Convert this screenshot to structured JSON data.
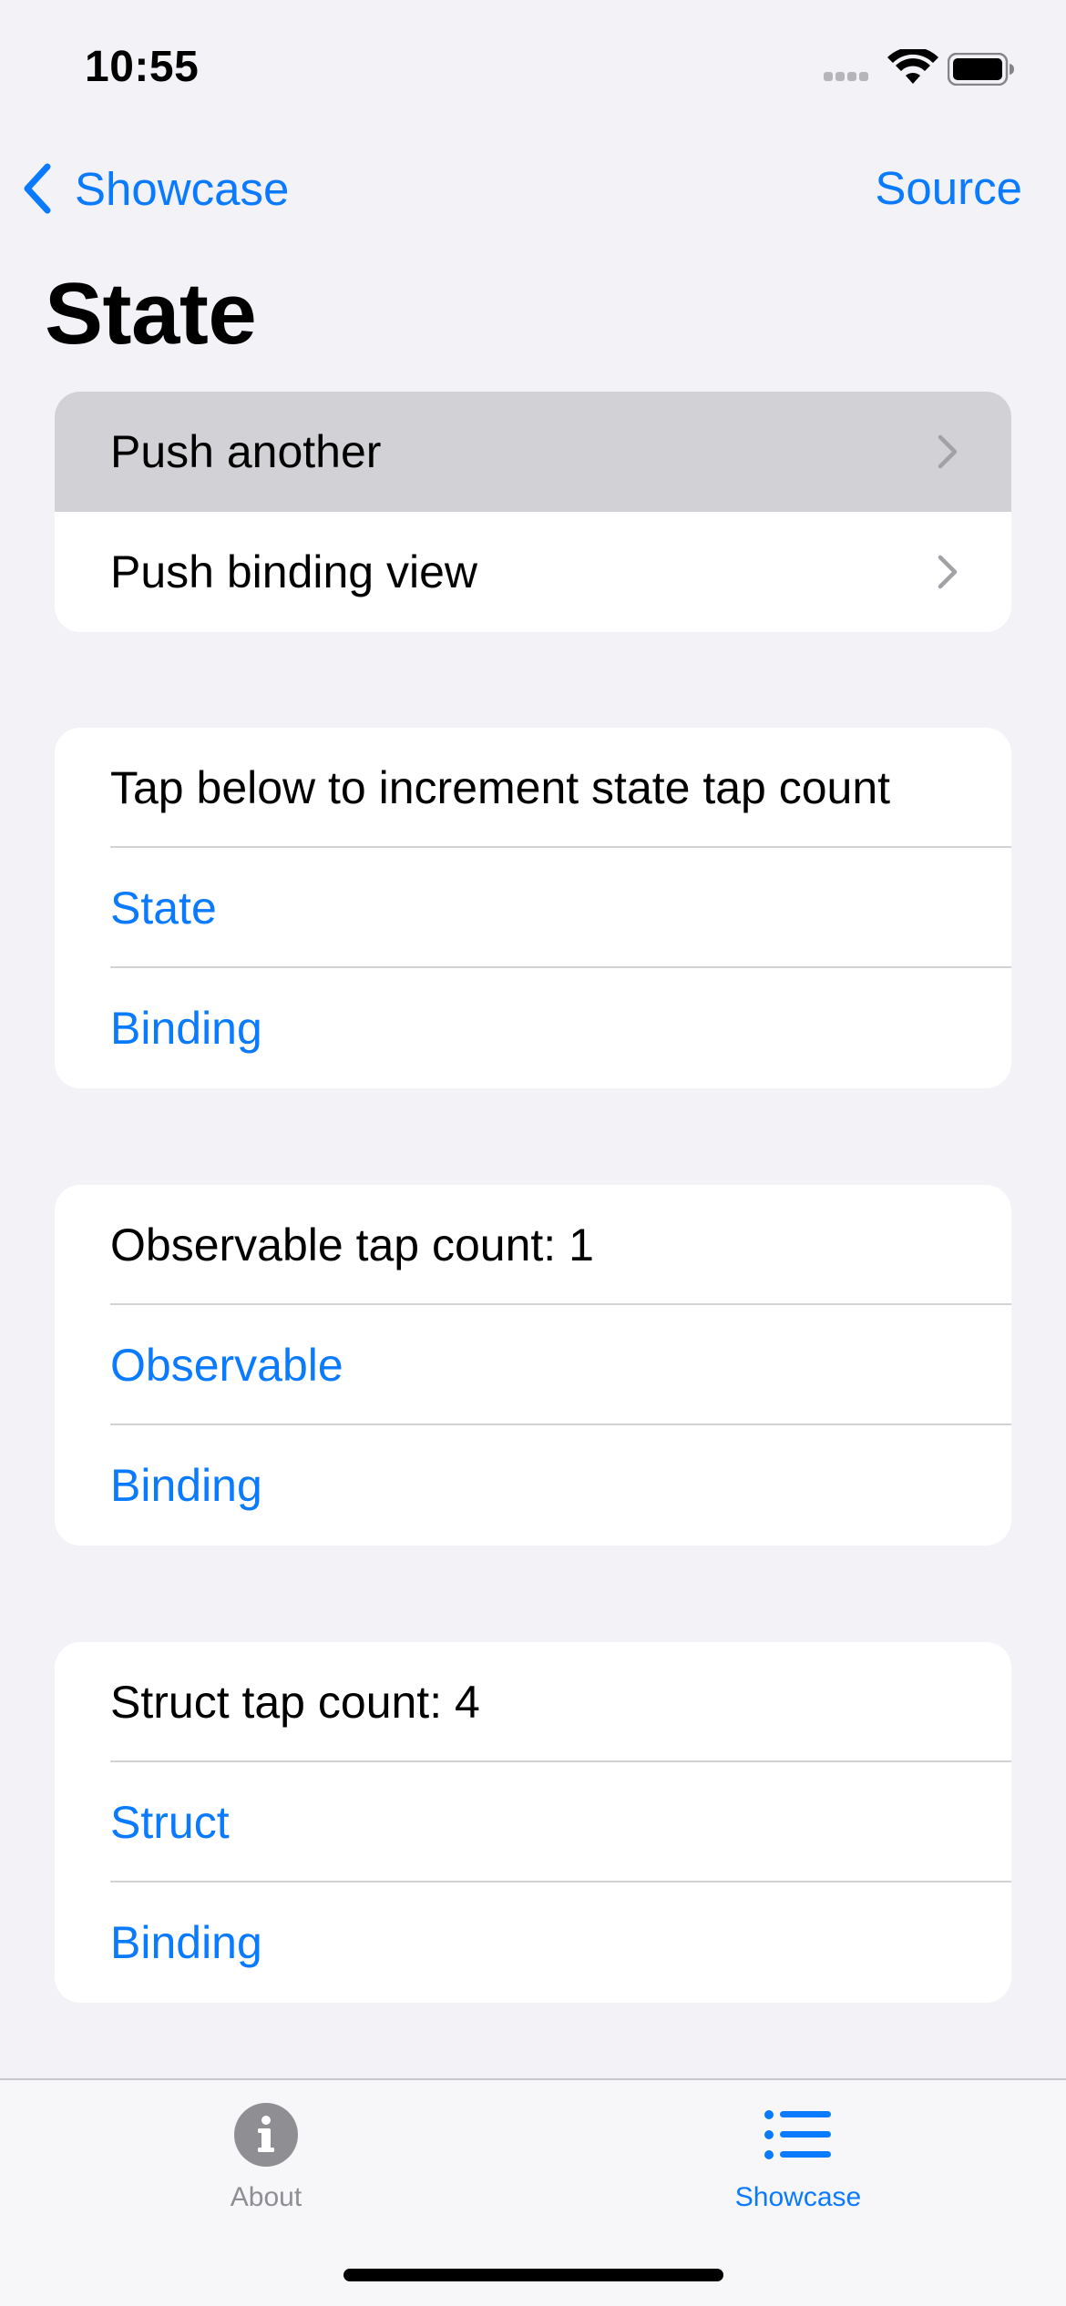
{
  "status_bar": {
    "time": "10:55"
  },
  "nav": {
    "back_label": "Showcase",
    "source_label": "Source",
    "title": "State"
  },
  "groups": [
    {
      "rows": [
        {
          "label": "Push another",
          "type": "navigation",
          "pressed": true
        },
        {
          "label": "Push binding view",
          "type": "navigation"
        }
      ]
    },
    {
      "rows": [
        {
          "label": "Tap below to increment state tap count",
          "type": "text"
        },
        {
          "label": "State",
          "type": "button"
        },
        {
          "label": "Binding",
          "type": "button"
        }
      ]
    },
    {
      "rows": [
        {
          "label": "Observable tap count: 1",
          "type": "text"
        },
        {
          "label": "Observable",
          "type": "button"
        },
        {
          "label": "Binding",
          "type": "button"
        }
      ]
    },
    {
      "rows": [
        {
          "label": "Struct tap count: 4",
          "type": "text"
        },
        {
          "label": "Struct",
          "type": "button"
        },
        {
          "label": "Binding",
          "type": "button"
        }
      ]
    }
  ],
  "tab_bar": {
    "items": [
      {
        "label": "About",
        "icon": "info-icon",
        "selected": false
      },
      {
        "label": "Showcase",
        "icon": "list-icon",
        "selected": true
      }
    ]
  },
  "colors": {
    "accent": "#0A7AFF",
    "background": "#F2F2F7",
    "pressed_row": "#D1D1D6",
    "inactive_tab": "#8E8E93"
  }
}
